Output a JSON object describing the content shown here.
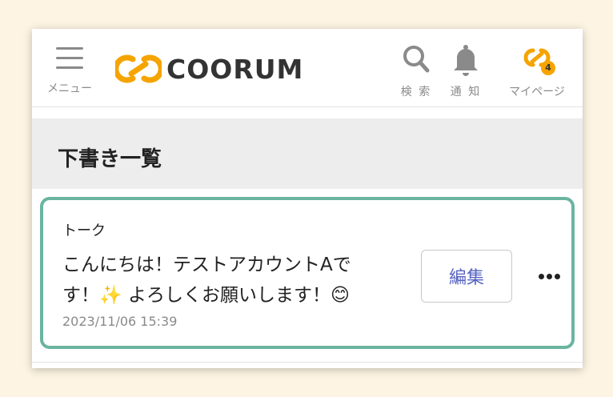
{
  "header": {
    "menu_label": "メニュー",
    "logo_text": "COORUM",
    "search_label": "検 索",
    "notify_label": "通 知",
    "mypage_label": "マイページ",
    "mypage_badge": "4",
    "icons": {
      "menu": "hamburger-icon",
      "search": "search-icon",
      "notify": "bell-icon",
      "logo": "coorum-logo"
    },
    "colors": {
      "logo_orange": "#f5a400",
      "icon_gray": "#8a8a8a"
    }
  },
  "section": {
    "title": "下書き一覧"
  },
  "draft": {
    "category": "トーク",
    "text_line1": "こんにちは！テストアカウントAで",
    "text_line2_a": "す！",
    "text_line2_sparkle": "✨",
    "text_line2_b": " よろしくお願いします！",
    "text_line2_emoji": "😊",
    "date": "2023/11/06 15:39",
    "edit_label": "編集",
    "colors": {
      "card_border": "#6bb5a0",
      "edit_text": "#5563c1"
    }
  }
}
